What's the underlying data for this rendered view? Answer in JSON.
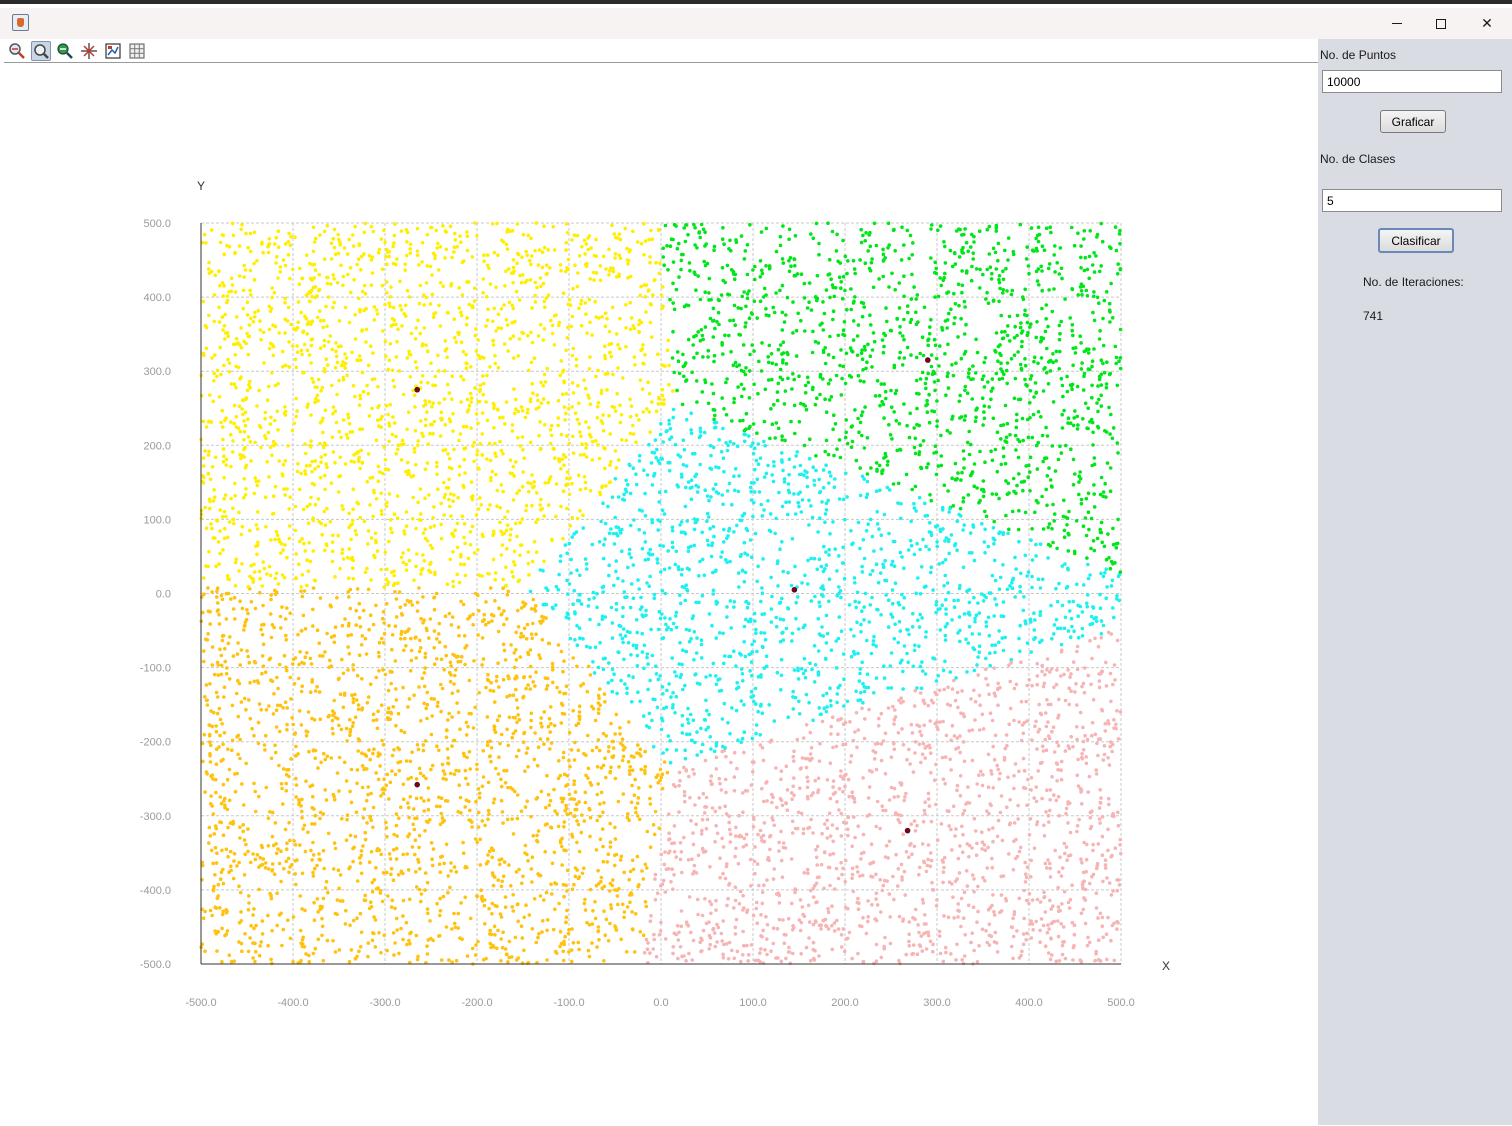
{
  "window": {
    "minimize_glyph": "",
    "maximize_glyph": "",
    "close_glyph": "✕",
    "app_icon": "java-cup-icon"
  },
  "toolbar": {
    "tools": [
      {
        "name": "zoom-in-icon"
      },
      {
        "name": "zoom-icon",
        "active": true
      },
      {
        "name": "zoom-out-icon"
      },
      {
        "name": "fit-icon"
      },
      {
        "name": "save-icon"
      },
      {
        "name": "grid-icon"
      }
    ]
  },
  "side_panel": {
    "points_label": "No. de Puntos",
    "points_value": "10000",
    "plot_button": "Graficar",
    "classes_label": "No. de Clases",
    "classes_value": "5",
    "classify_button": "Clasificar",
    "iterations_label": "No. de Iteraciones:",
    "iterations_value": "741"
  },
  "colors": {
    "yellow": "#ffee00",
    "gold": "#ffc20e",
    "green": "#00e61a",
    "cyan": "#1ef0f0",
    "pink": "#f6b4b4",
    "grid": "#c8c8c8",
    "axis": "#333333"
  },
  "chart_data": {
    "type": "scatter",
    "xlabel": "X",
    "ylabel": "Y",
    "xlim": [
      -500,
      500
    ],
    "ylim": [
      -500,
      500
    ],
    "x_ticks": [
      "-500.0",
      "-400.0",
      "-300.0",
      "-200.0",
      "-100.0",
      "0.0",
      "100.0",
      "200.0",
      "300.0",
      "400.0",
      "500.0"
    ],
    "y_ticks": [
      "500.0",
      "400.0",
      "300.0",
      "200.0",
      "100.0",
      "0.0",
      "-100.0",
      "-200.0",
      "-300.0",
      "-400.0",
      "-500.0"
    ],
    "grid": true,
    "n_points": 10000,
    "series": [
      {
        "color": "#ffee00",
        "centroid": [
          -265,
          275
        ]
      },
      {
        "color": "#00e61a",
        "centroid": [
          290,
          315
        ]
      },
      {
        "color": "#1ef0f0",
        "centroid": [
          145,
          5
        ]
      },
      {
        "color": "#ffc20e",
        "centroid": [
          -265,
          -258
        ]
      },
      {
        "color": "#f6b4b4",
        "centroid": [
          268,
          -320
        ]
      }
    ]
  }
}
